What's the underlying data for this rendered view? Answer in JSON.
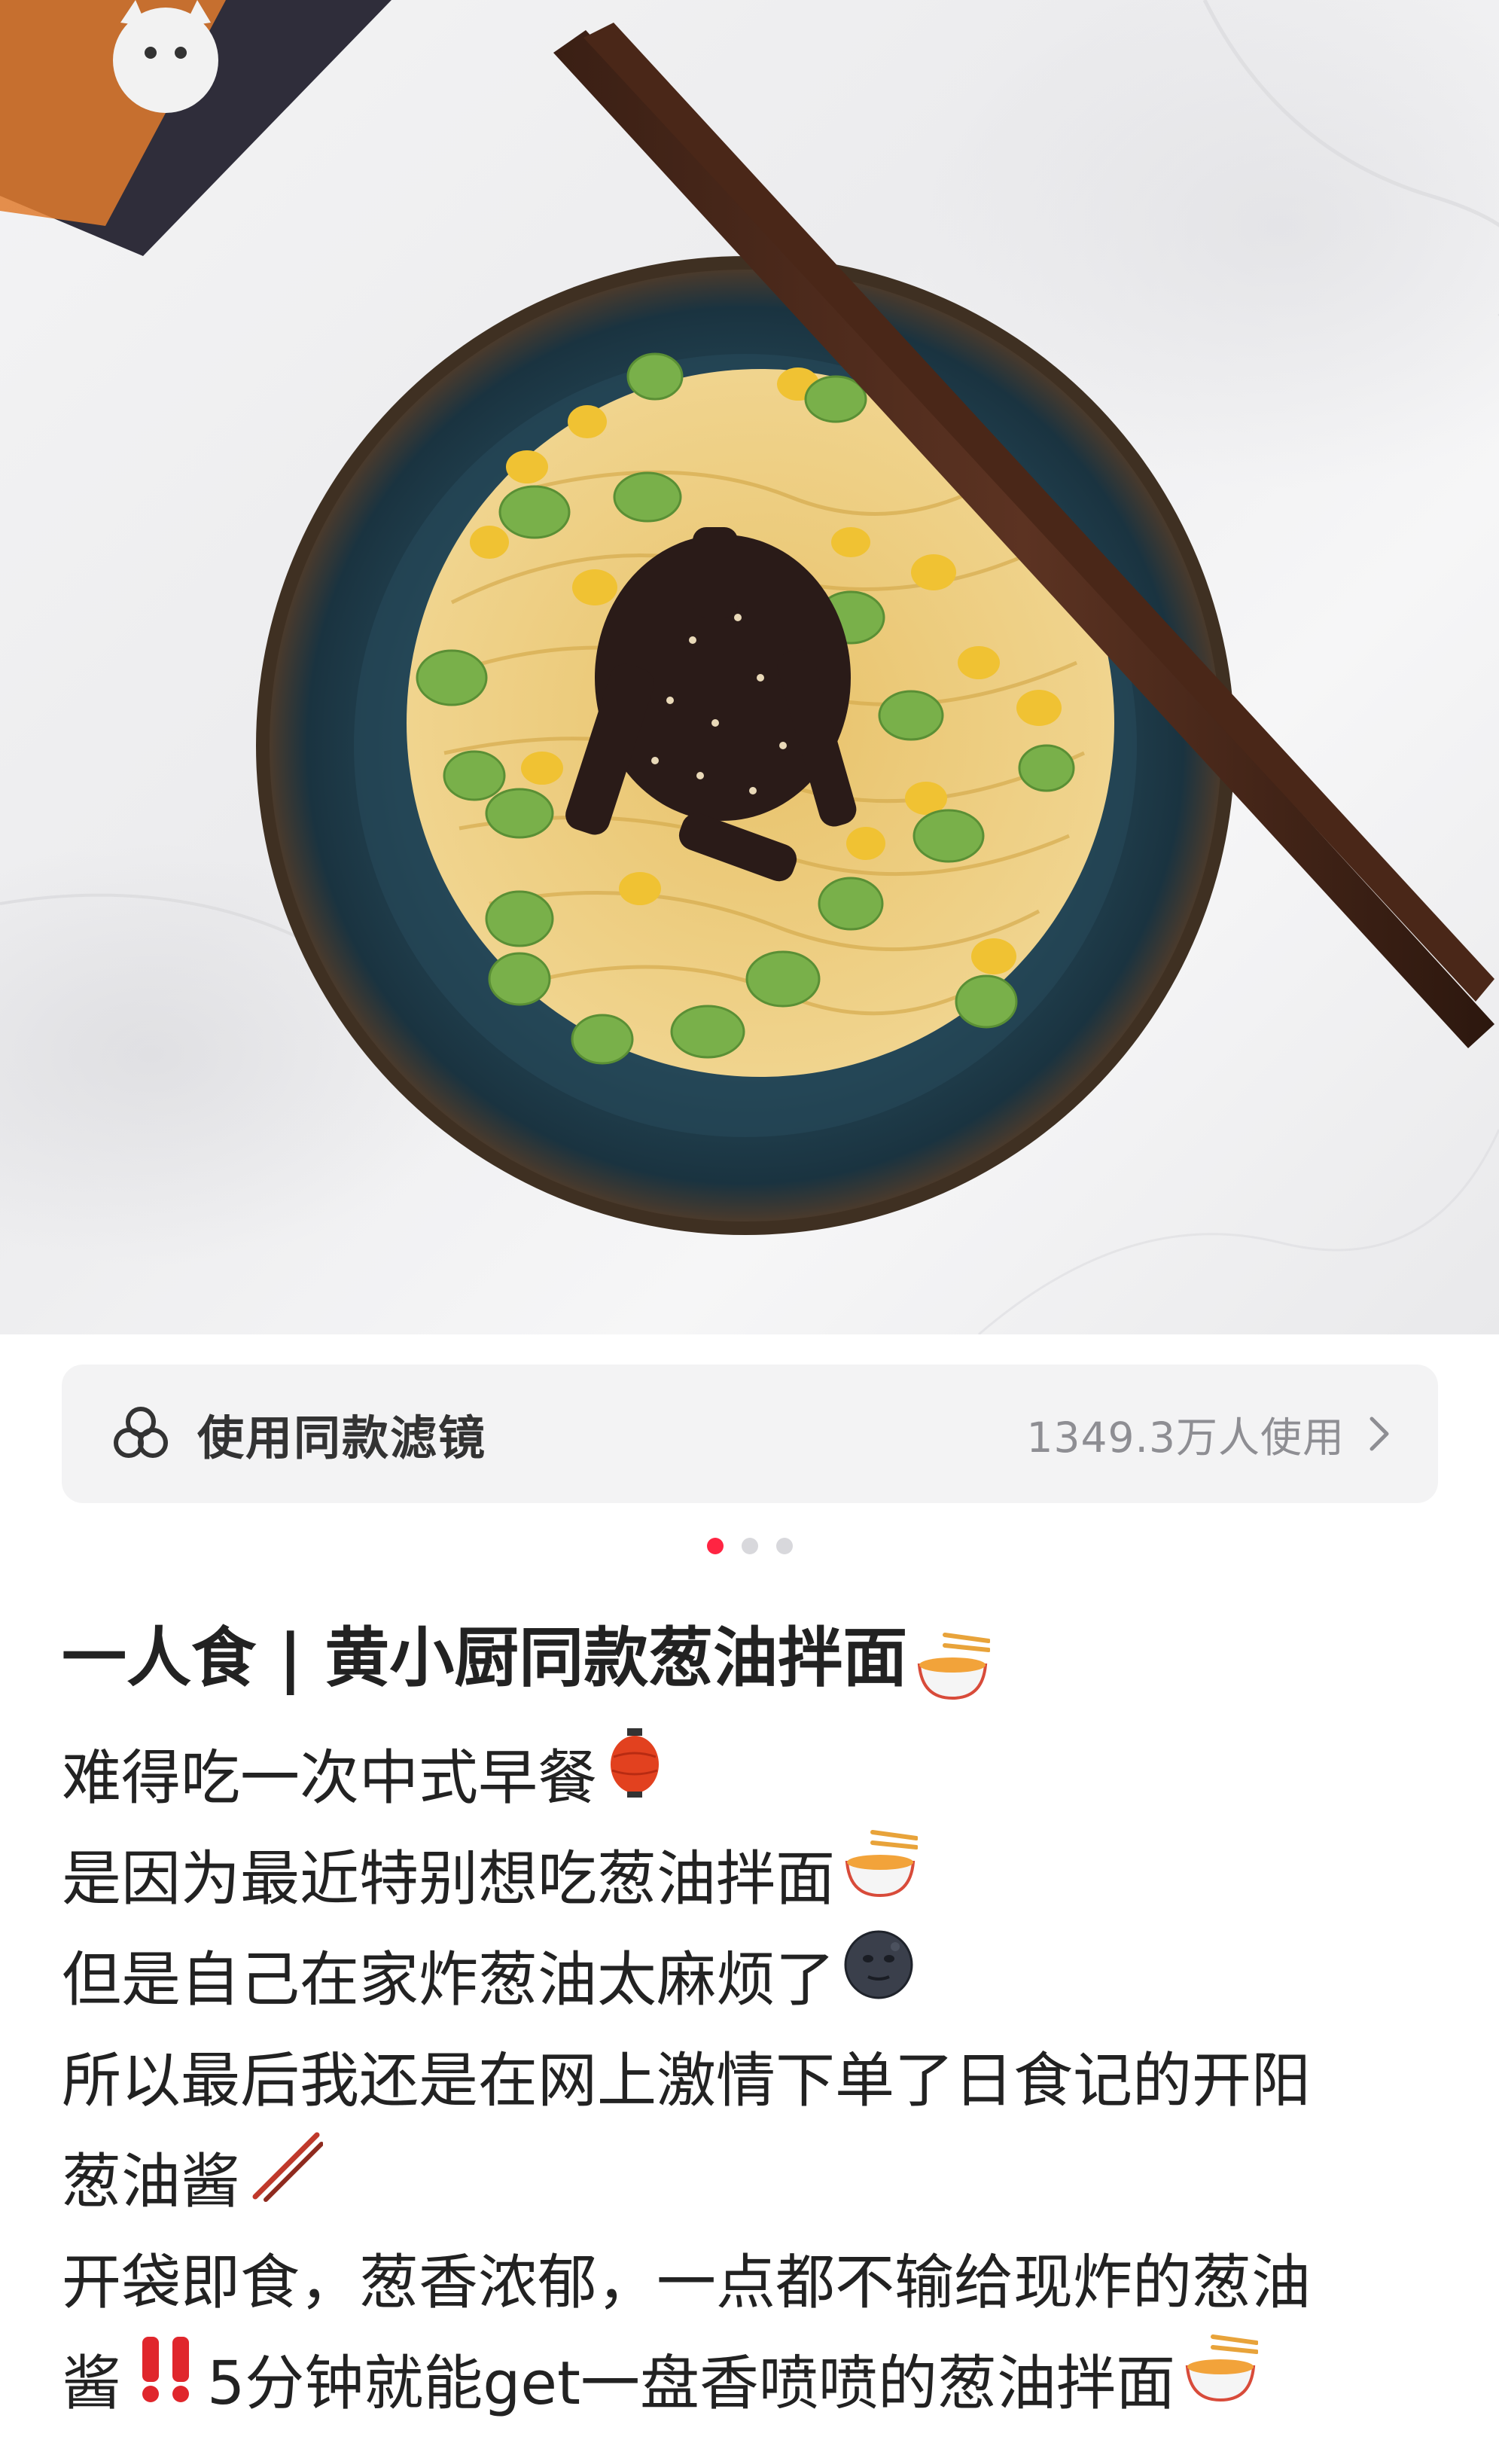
{
  "photo": {
    "icon": "noodle-bowl-photo"
  },
  "filter_bar": {
    "icon": "filter-icon",
    "label": "使用同款滤镜",
    "count": "1349.3万人使用"
  },
  "carousel": {
    "total": 3,
    "active_index": 0,
    "active_color": "#ff2442"
  },
  "post": {
    "title": "一人食 | 黄小厨同款葱油拌面",
    "lines": [
      "难得吃一次中式早餐",
      "是因为最近特别想吃葱油拌面",
      "但是自己在家炸葱油太麻烦了",
      "所以最后我还是在网上激情下单了日食记的开阳",
      "葱油酱",
      "开袋即食，葱香浓郁，一点都不输给现炸的葱油",
      "5分钟就能get一盘香喷喷的葱油拌面"
    ],
    "line_6_prefix": "酱"
  },
  "emojis": [
    "noodle-bowl-icon",
    "lantern-icon",
    "new-moon-face-icon",
    "chopsticks-icon",
    "double-exclamation-icon"
  ]
}
